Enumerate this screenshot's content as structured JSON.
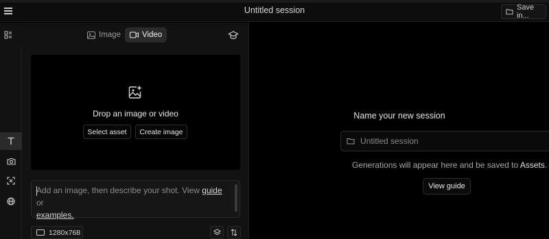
{
  "header": {
    "session_title": "Untitled session",
    "save_label": "Save in..."
  },
  "left": {
    "mode_tabs": [
      {
        "label": "Image",
        "icon": "image-icon",
        "active": false
      },
      {
        "label": "Video",
        "icon": "video-icon",
        "active": true
      }
    ],
    "tools": [
      {
        "name": "text-tool",
        "icon": "text-T-icon",
        "active": true
      },
      {
        "name": "camera-tool",
        "icon": "camera-icon",
        "active": false
      },
      {
        "name": "scan-tool",
        "icon": "scan-icon",
        "active": false
      },
      {
        "name": "globe-tool",
        "icon": "globe-icon",
        "active": false
      }
    ],
    "dropzone": {
      "text": "Drop an image or video",
      "select_asset": "Select asset",
      "create_image": "Create image"
    },
    "prompt": {
      "text_before": "Add an image, then describe your shot. View ",
      "guide_link": "guide",
      "text_middle": " or ",
      "examples_link": "examples."
    },
    "resolution": "1280x768"
  },
  "right": {
    "name_label": "Name your new session",
    "name_placeholder": "Untitled session",
    "generations_text": "Generations will appear here and be saved to ",
    "assets_word": "Assets",
    "view_guide": "View guide"
  },
  "colors": {
    "background": "#000000",
    "panel": "#121212",
    "active_tab": "#2a2a2a",
    "border": "#2b2b2b"
  }
}
